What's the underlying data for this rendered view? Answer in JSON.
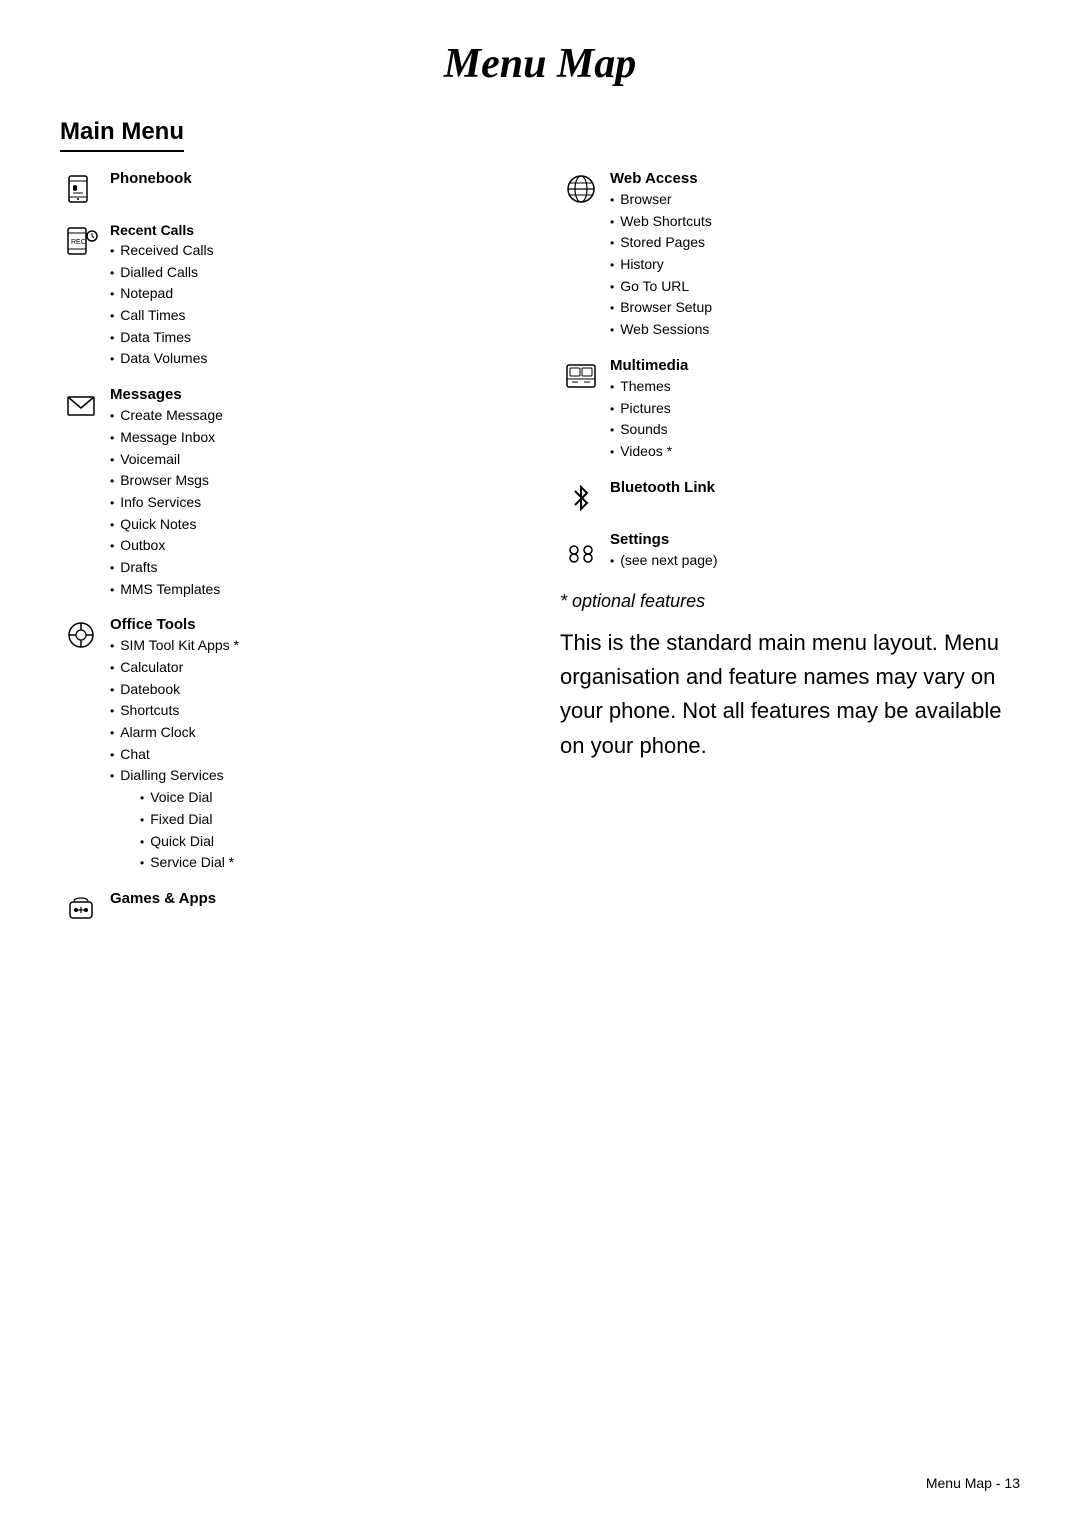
{
  "page": {
    "title": "Menu Map",
    "section": "Main Menu",
    "footer": "Menu Map - 13"
  },
  "left_column": [
    {
      "icon": "phonebook-icon",
      "heading": "Phonebook",
      "subheading": null,
      "items": []
    },
    {
      "icon": "recent-calls-icon",
      "heading": null,
      "subheading": "Recent Calls",
      "items": [
        "Received Calls",
        "Dialled Calls",
        "Notepad",
        "Call Times",
        "Data Times",
        "Data Volumes"
      ]
    },
    {
      "icon": "messages-icon",
      "heading": "Messages",
      "subheading": null,
      "items": [
        "Create Message",
        "Message Inbox",
        "Voicemail",
        "Browser Msgs",
        "Info Services",
        "Quick Notes",
        "Outbox",
        "Drafts",
        "MMS Templates"
      ]
    },
    {
      "icon": "office-tools-icon",
      "heading": "Office Tools",
      "subheading": null,
      "items": [
        "SIM Tool Kit Apps *",
        "Calculator",
        "Datebook",
        "Shortcuts",
        "Alarm Clock",
        "Chat",
        "Dialling Services"
      ],
      "sub_group": {
        "label": "Dialling Services",
        "sub_items": [
          "Voice Dial",
          "Fixed Dial",
          "Quick Dial",
          "Service Dial *"
        ]
      }
    },
    {
      "icon": "games-apps-icon",
      "heading": "Games & Apps",
      "subheading": null,
      "items": []
    }
  ],
  "right_column": [
    {
      "icon": "web-access-icon",
      "heading": "Web Access",
      "items": [
        "Browser",
        "Web Shortcuts",
        "Stored Pages",
        "History",
        "Go To URL",
        "Browser Setup",
        "Web Sessions"
      ]
    },
    {
      "icon": "multimedia-icon",
      "heading": "Multimedia",
      "items": [
        "Themes",
        "Pictures",
        "Sounds",
        "Videos *"
      ]
    },
    {
      "icon": "bluetooth-icon",
      "heading": "Bluetooth Link",
      "items": []
    },
    {
      "icon": "settings-icon",
      "heading": "Settings",
      "items": [
        "(see next page)"
      ]
    }
  ],
  "optional_features_label": "* optional features",
  "description": "This is the standard main menu layout. Menu organisation and feature names may vary on your phone. Not all features may be available on your phone."
}
